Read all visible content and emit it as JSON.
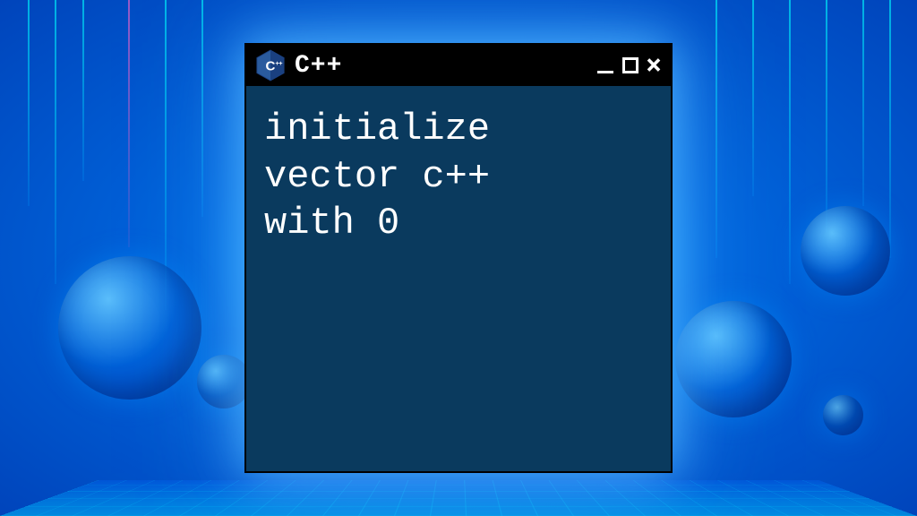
{
  "window": {
    "title": "C++",
    "content": "initialize\nvector c++\nwith 0",
    "icon_name": "cpp-hexagon-icon"
  }
}
